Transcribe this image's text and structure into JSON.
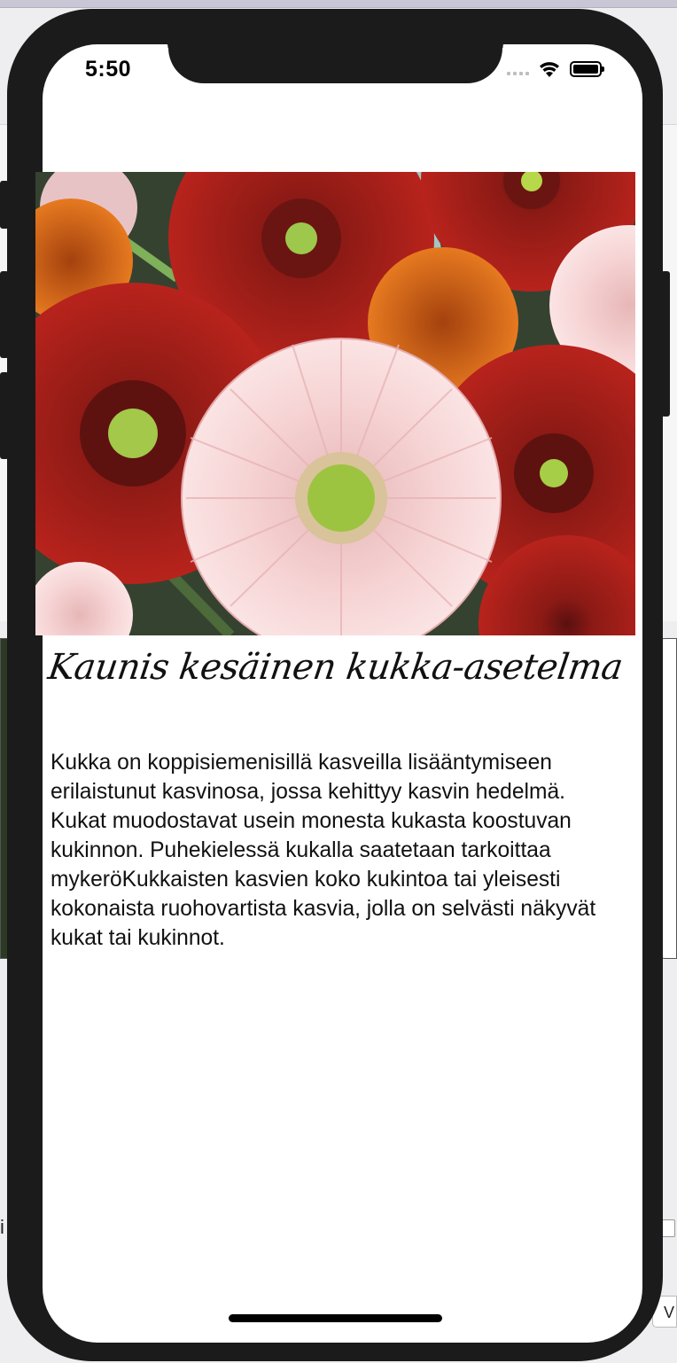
{
  "status_bar": {
    "time": "5:50"
  },
  "article": {
    "image_alt": "Gerbera flowers",
    "title": "Kaunis kesäinen kukka-asetelma",
    "body": "Kukka on koppisiemenisillä kasveilla lisääntymiseen erilaistunut kasvinosa, jossa kehittyy kasvin hedelmä. Kukat muodostavat usein monesta kukasta koostuvan kukinnon. Puhekielessä kukalla saatetaan tarkoittaa mykeröKukkaisten kasvien koko kukintoa tai yleisesti kokonaista ruohovartista kasvia, jolla on selvästi näkyvät kukat tai kukinnot."
  },
  "background": {
    "left_fragment": "i",
    "right_button": "V"
  },
  "colors": {
    "frame": "#1b1b1b",
    "screen": "#ffffff",
    "text": "#111111"
  }
}
